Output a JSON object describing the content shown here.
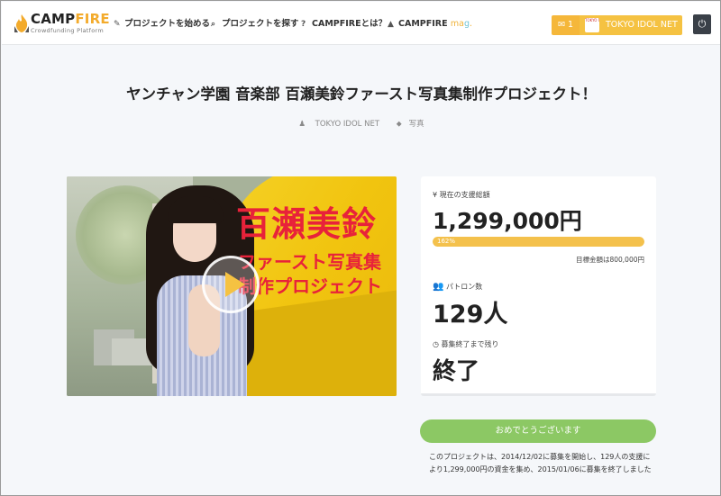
{
  "header": {
    "logo": {
      "word_a": "CAMP",
      "word_b": "FIRE",
      "tagline": "Crowdfunding Platform"
    },
    "nav": [
      {
        "icon": "edit-icon",
        "glyph": "✎",
        "label": "プロジェクトを始める"
      },
      {
        "icon": "search-icon",
        "glyph": "⌕",
        "label": "プロジェクトを探す"
      },
      {
        "icon": "question-icon",
        "glyph": "?",
        "label": "CAMPFIREとは？"
      },
      {
        "icon": "flask-icon",
        "glyph": "▲",
        "label": "CAMPFIRE"
      }
    ],
    "mag": {
      "a": "ma",
      "b": "g",
      "c": "."
    },
    "mail_count": "1",
    "user_name": "TOKYO IDOL NET",
    "avatar_text": "TOKYO IDOL NET"
  },
  "project": {
    "title": "ヤンチャン学園 音楽部 百瀬美鈴ファースト写真集制作プロジェクト！",
    "owner": "TOKYO IDOL NET",
    "category": "写真",
    "hero_title": "百瀬美鈴",
    "hero_sub1": "ファースト写真集",
    "hero_sub2": "制作プロジェクト"
  },
  "stats": {
    "raised_label": "現在の支援総額",
    "raised_value": "1,299,000円",
    "progress_label": "162%",
    "progress_percent": 162,
    "goal_text": "目標金額は800,000円",
    "backers_label": "パトロン数",
    "backers_value": "129人",
    "remaining_label": "募集終了まで残り",
    "remaining_value": "終了"
  },
  "complete": {
    "button_label": "おめでとうございます",
    "message": "このプロジェクトは、2014/12/02に募集を開始し、129人の支援により1,299,000円の資金を集め、2015/01/06に募集を終了しました"
  },
  "colors": {
    "brand": "#f3ab2c",
    "accent": "#f5c242",
    "success": "#8cc864",
    "hero_text": "#e8223a"
  }
}
